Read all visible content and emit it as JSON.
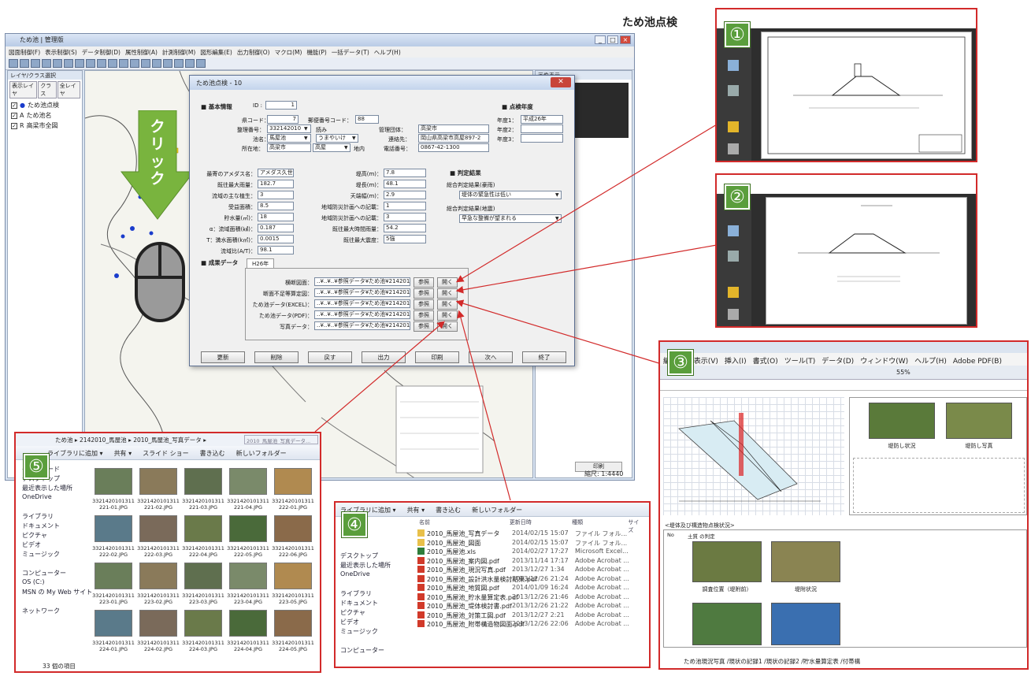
{
  "page_title": "ため池点検",
  "gis": {
    "title": "ため池 | 管理版",
    "menu": [
      "図面制御(F)",
      "表示制御(S)",
      "データ制御(D)",
      "属性制御(A)",
      "計測制御(M)",
      "図形編集(E)",
      "出力制御(O)",
      "マクロ(M)",
      "機能(P)",
      "一括データ(T)",
      "ヘルプ(H)"
    ],
    "layer_panel_title": "レイヤ/クラス選択",
    "layer_tabs": [
      "表示レイヤ",
      "クラス",
      "全レイヤ"
    ],
    "layers": [
      {
        "label": "ため池点検",
        "symbol": "●"
      },
      {
        "label": "ため池名",
        "symbol": "A"
      },
      {
        "label": "高梁市全図",
        "symbol": "R"
      }
    ],
    "right_panel_title": "画像表示",
    "right_button": "印刷",
    "statusbar": "縮尺: 1:4440",
    "click_label": "クリック"
  },
  "dialog": {
    "title": "ため池点検 - 10",
    "sec_basic": "■ 基本情報",
    "sec_year": "■ 点検年度",
    "sec_judge": "■ 判定結果",
    "sec_results": "■ 成果データ",
    "id_label": "ID :",
    "id_value": "1",
    "fields_left": [
      {
        "label": "県コード：",
        "value": "7"
      },
      {
        "label": "整理番号：",
        "value": "332142010"
      },
      {
        "label": "池名：",
        "value": "馬屋池"
      },
      {
        "label": "所在地：",
        "value": "高梁市"
      }
    ],
    "yomi_label": "読み",
    "yomi_value": "うまやいけ",
    "area_value": "高屋",
    "area_suffix": "地内",
    "postal_label": "郵便番号コード：",
    "postal_value": "88",
    "fields_mid": [
      {
        "label": "管理団体：",
        "value": "高梁市"
      },
      {
        "label": "連絡先：",
        "value": "岡山県高梁市高屋897-2"
      },
      {
        "label": "電話番号：",
        "value": "0867-42-1300"
      }
    ],
    "years": [
      {
        "label": "年度1：",
        "value": "平成26年"
      },
      {
        "label": "年度2：",
        "value": ""
      },
      {
        "label": "年度3：",
        "value": ""
      }
    ],
    "fields_spec_left": [
      {
        "label": "最寄のアメダス名：",
        "value": "アメダス久世"
      },
      {
        "label": "既往最大雨量：",
        "value": "182.7"
      },
      {
        "label": "流域の主な植生：",
        "value": "3"
      },
      {
        "label": "受益面積：",
        "value": "8.5"
      },
      {
        "label": "貯水量(㎥)：",
        "value": "18"
      },
      {
        "label": "α：流域面積(㎢)：",
        "value": "0.187"
      },
      {
        "label": "T：満水面積(k㎡)：",
        "value": "0.0015"
      },
      {
        "label": "流域比(A/T)：",
        "value": "98.1"
      }
    ],
    "fields_spec_right": [
      {
        "label": "堤高(m)：",
        "value": "7.8"
      },
      {
        "label": "堤長(m)：",
        "value": "48.1"
      },
      {
        "label": "天端幅(m)：",
        "value": "2.9"
      },
      {
        "label": "地域防災計画への記載：",
        "value": "1"
      },
      {
        "label": "地域防災計画への記載：",
        "value": "3"
      },
      {
        "label": "既往最大時間雨量：",
        "value": "54.2"
      },
      {
        "label": "既往最大震度：",
        "value": "5強"
      }
    ],
    "judge_label1": "総合判定結果(豪雨)",
    "judge_value1": "堤体の緊急性は低い",
    "judge_label2": "総合判定結果(地震)",
    "judge_value2": "早急な整備が望まれる",
    "year_tab": "H26年",
    "results": [
      {
        "label": "横断図面：",
        "path": "..¥..¥..¥参照データ¥ため池¥2142010_"
      },
      {
        "label": "断面不足等算定図：",
        "path": "..¥..¥..¥参照データ¥ため池¥2142010_"
      },
      {
        "label": "ため池データ(EXCEL)：",
        "path": "..¥..¥..¥参照データ¥ため池¥2142010_"
      },
      {
        "label": "ため池データ(PDF)：",
        "path": "..¥..¥..¥参照データ¥ため池¥2142010_"
      },
      {
        "label": "写真データ：",
        "path": "..¥..¥..¥参照データ¥ため池¥2142010_"
      }
    ],
    "ref_btn": "参照",
    "open_btn": "開く",
    "buttons": [
      "更新",
      "削除",
      "戻す",
      "出力",
      "印刷",
      "次へ",
      "終了"
    ]
  },
  "badges": [
    "①",
    "②",
    "③",
    "④",
    "⑤"
  ],
  "excel": {
    "menu": [
      "編集(E)",
      "表示(V)",
      "挿入(I)",
      "書式(O)",
      "ツール(T)",
      "データ(D)",
      "ウィンドウ(W)",
      "ヘルプ(H)",
      "Adobe PDF(B)"
    ],
    "zoom": "55%",
    "section_label": "<堤体及び構造物点検状況>",
    "photo_caps": [
      "堤防し状況",
      "堤防し写真",
      "調査位置（堤附前）",
      "堤附状況"
    ],
    "cell_labels": [
      "No",
      "土質 の判定"
    ],
    "sheet_tabs": "ため池現況写真 /現状の記録1 /現状の記録2 /貯水量算定表 /付帯構"
  },
  "explorer_pdf": {
    "toolbar": [
      "ライブラリに追加 ▾",
      "共有 ▾",
      "書き込む",
      "新しいフォルダー"
    ],
    "headers": [
      "名前",
      "更新日時",
      "種類",
      "サイズ"
    ],
    "nav": [
      "デスクトップ",
      "最近表示した場所",
      "OneDrive",
      "",
      "ライブラリ",
      "ドキュメント",
      "ピクチャ",
      "ビデオ",
      "ミュージック",
      "",
      "コンピューター"
    ],
    "files": [
      {
        "name": "2010_馬屋池_写真データ",
        "date": "2014/02/15 15:07",
        "type": "ファイル フォル...",
        "kind": "folder"
      },
      {
        "name": "2010_馬屋池_図面",
        "date": "2014/02/15 15:07",
        "type": "ファイル フォル...",
        "kind": "folder"
      },
      {
        "name": "2010_馬屋池.xls",
        "date": "2014/02/27 17:27",
        "type": "Microsoft Excel...",
        "kind": "xls"
      },
      {
        "name": "2010_馬屋池_案内図.pdf",
        "date": "2013/11/14 17:17",
        "type": "Adobe Acrobat ...",
        "kind": "pdf"
      },
      {
        "name": "2010_馬屋池_現況写真.pdf",
        "date": "2013/12/27 1:34",
        "type": "Adobe Acrobat ...",
        "kind": "pdf"
      },
      {
        "name": "2010_馬屋池_設計洪水量検討結果.pdf",
        "date": "2013/12/26 21:24",
        "type": "Adobe Acrobat ...",
        "kind": "pdf"
      },
      {
        "name": "2010_馬屋池_地質図.pdf",
        "date": "2014/01/09 16:24",
        "type": "Adobe Acrobat ...",
        "kind": "pdf"
      },
      {
        "name": "2010_馬屋池_貯水量算定表.pdf",
        "date": "2013/12/26 21:46",
        "type": "Adobe Acrobat ...",
        "kind": "pdf"
      },
      {
        "name": "2010_馬屋池_堤体検討書.pdf",
        "date": "2013/12/26 21:22",
        "type": "Adobe Acrobat ...",
        "kind": "pdf"
      },
      {
        "name": "2010_馬屋池_対策工図.pdf",
        "date": "2013/12/27 2:21",
        "type": "Adobe Acrobat ...",
        "kind": "pdf"
      },
      {
        "name": "2010_馬屋池_附帯構造物図面.pdf",
        "date": "2013/12/26 22:06",
        "type": "Adobe Acrobat ...",
        "kind": "pdf"
      }
    ]
  },
  "explorer_photo": {
    "breadcrumb": "ため池 ▸ 2142010_馬屋池 ▸ 2010_馬屋池_写真データ ▸",
    "search": "2010_馬屋池_写真データ...",
    "toolbar": [
      "ライブラリに追加 ▾",
      "共有 ▾",
      "スライド ショー",
      "書き込む",
      "新しいフォルダー"
    ],
    "nav": [
      "ダウンロード",
      "デスクトップ",
      "最近表示した場所",
      "OneDrive",
      "",
      "ライブラリ",
      "ドキュメント",
      "ピクチャ",
      "ビデオ",
      "ミュージック",
      "",
      "コンピューター",
      "OS (C:)",
      "MSN の My Web サイト",
      "",
      "ネットワーク"
    ],
    "status": "33 個の項目",
    "photos": [
      "3321420101311 221-01.JPG",
      "3321420101311 221-02.JPG",
      "3321420101311 221-03.JPG",
      "3321420101311 221-04.JPG",
      "3321420101311 222-01.JPG",
      "3321420101311 222-02.JPG",
      "3321420101311 222-03.JPG",
      "3321420101311 222-04.JPG",
      "3321420101311 222-05.JPG",
      "3321420101311 222-06.JPG",
      "3321420101311 223-01.JPG",
      "3321420101311 223-02.JPG",
      "3321420101311 223-03.JPG",
      "3321420101311 223-04.JPG",
      "3321420101311 223-05.JPG",
      "3321420101311 224-01.JPG",
      "3321420101311 224-02.JPG",
      "3321420101311 224-03.JPG",
      "3321420101311 224-04.JPG",
      "3321420101311 224-05.JPG"
    ]
  }
}
